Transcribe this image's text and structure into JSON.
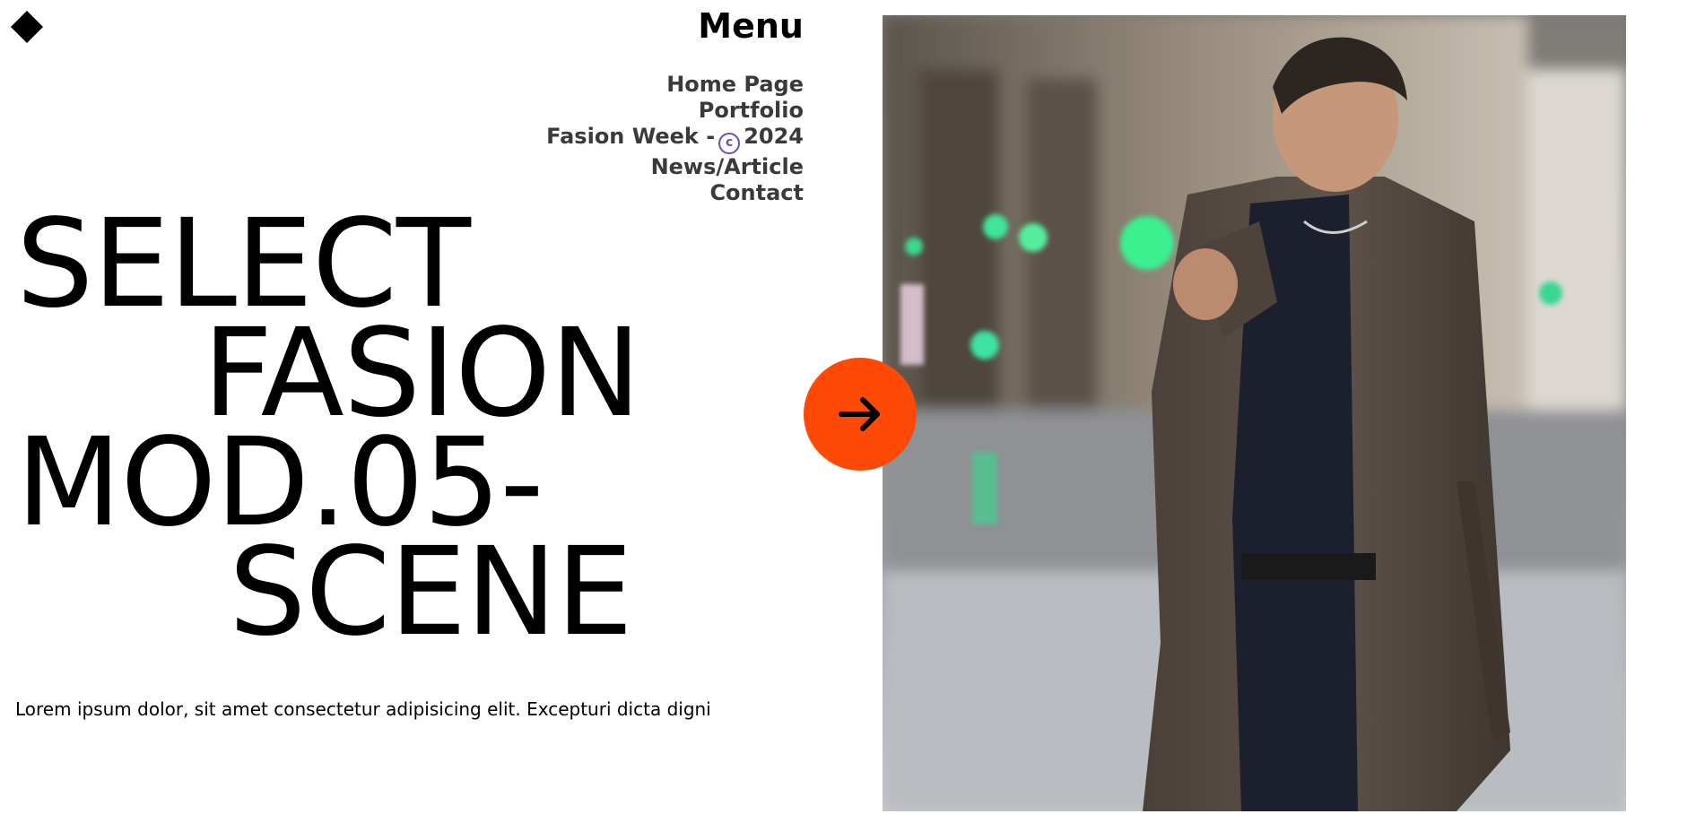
{
  "logo": {
    "icon": "diamond-logo-icon"
  },
  "menu": {
    "title": "Menu",
    "items": [
      {
        "label": "Home Page"
      },
      {
        "label": "Portfolio"
      },
      {
        "label_before": "Fasion Week -",
        "icon": "copyright-circle-icon",
        "icon_glyph": "c",
        "label_after": "2024"
      },
      {
        "label": "News/Article"
      },
      {
        "label": "Contact"
      }
    ]
  },
  "hero": {
    "lines": [
      "SELECT",
      "FASION",
      "MOD.05-",
      "SCENE"
    ]
  },
  "description": "Lorem ipsum dolor, sit amet consectetur adipisicing elit. Excepturi dicta digni",
  "cta": {
    "icon": "arrow-right-icon",
    "color": "#ff4a07"
  },
  "photo": {
    "subject": "man in trench coat on rainy city street"
  },
  "colors": {
    "accent": "#ff4a07",
    "text": "#000000",
    "nav_text": "#3a3a3a",
    "copyright_icon": "#6a4cc9"
  }
}
